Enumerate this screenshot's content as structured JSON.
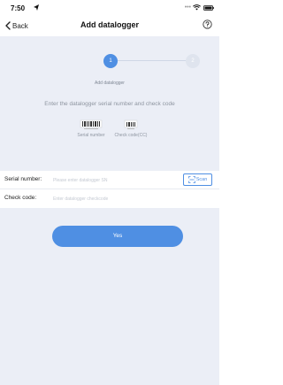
{
  "status_bar": {
    "time": "7:50"
  },
  "nav": {
    "back_label": "Back",
    "title": "Add datalogger"
  },
  "steps": [
    {
      "number": "1",
      "label": "Add datalogger",
      "active": true
    },
    {
      "number": "2",
      "active": false
    }
  ],
  "instruction": "Enter the datalogger serial number and check code",
  "examples": {
    "serial_caption": "Serial number",
    "check_caption": "Check code(CC)"
  },
  "form": {
    "serial": {
      "label": "Serial number:",
      "placeholder": "Please enter datalogger SN",
      "value": ""
    },
    "check": {
      "label": "Check code:",
      "placeholder": "Enter datalogger checkcode",
      "value": ""
    },
    "scan_label": "Scan"
  },
  "submit_label": "Yes",
  "colors": {
    "accent": "#4f8fe3",
    "background": "#ebeef6",
    "step_inactive": "#dfe4ee"
  },
  "icons": {
    "back": "chevron-left-icon",
    "help": "question-circle-icon",
    "scan": "scan-frame-icon",
    "location": "location-arrow-icon",
    "wifi": "wifi-icon",
    "battery": "battery-icon"
  }
}
